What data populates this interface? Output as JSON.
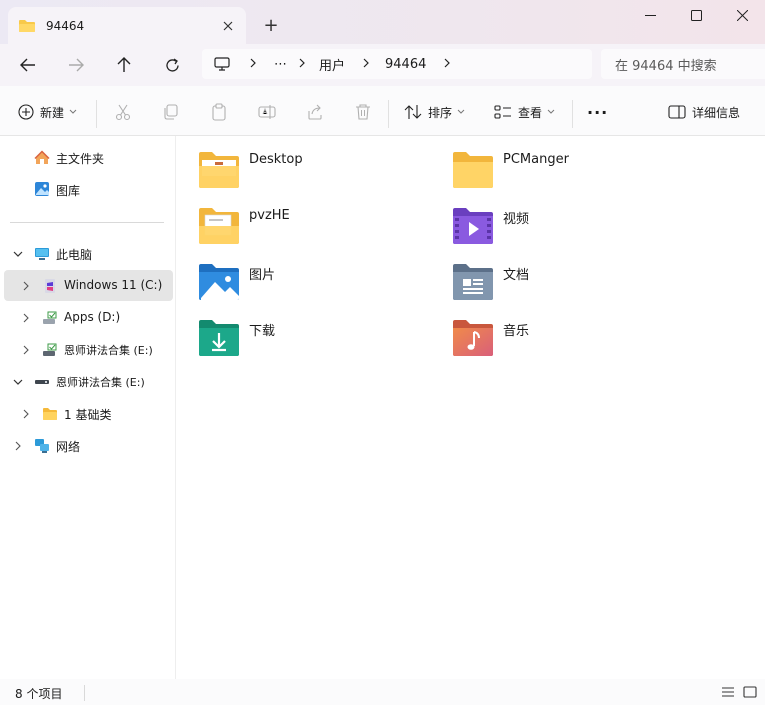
{
  "window": {
    "tab_title": "94464",
    "new_tab_symbol": "+"
  },
  "address": {
    "crumbs": [
      "用户",
      "94464"
    ],
    "ellipsis": "⋯",
    "search_placeholder": "在 94464 中搜索"
  },
  "toolbar": {
    "new_label": "新建",
    "sort_label": "排序",
    "view_label": "查看",
    "more_label": "···",
    "details_label": "详细信息"
  },
  "sidebar": {
    "quick": [
      {
        "label": "主文件夹",
        "icon": "home-icon"
      },
      {
        "label": "图库",
        "icon": "gallery-icon"
      }
    ],
    "this_pc": "此电脑",
    "drives": [
      {
        "label": "Windows 11 (C:)",
        "icon": "windows-drive-icon",
        "selected": true
      },
      {
        "label": "Apps (D:)",
        "icon": "drive-icon",
        "selected": false
      },
      {
        "label": "恩师讲法合集 (E:)",
        "icon": "drive-icon",
        "selected": false
      }
    ],
    "usb": "恩师讲法合集 (E:)",
    "usb_child": "1 基础类",
    "network": "网络"
  },
  "items": [
    {
      "label": "Desktop",
      "icon": "folder-desktop-icon"
    },
    {
      "label": "PCManger",
      "icon": "folder-icon"
    },
    {
      "label": "pvzHE",
      "icon": "folder-documents-icon"
    },
    {
      "label": "视频",
      "icon": "videos-folder-icon"
    },
    {
      "label": "图片",
      "icon": "pictures-folder-icon"
    },
    {
      "label": "文档",
      "icon": "documents-folder-icon"
    },
    {
      "label": "下载",
      "icon": "downloads-folder-icon"
    },
    {
      "label": "音乐",
      "icon": "music-folder-icon"
    }
  ],
  "status": {
    "count": "8 个项目"
  },
  "colors": {
    "folder_yellow": "#f8c94a",
    "video_purple": "#7b4fd0",
    "pictures_blue": "#2a7fd4",
    "documents_gray": "#7a8ea6",
    "downloads_teal": "#1aa386",
    "music_orange": "#e1705b"
  }
}
